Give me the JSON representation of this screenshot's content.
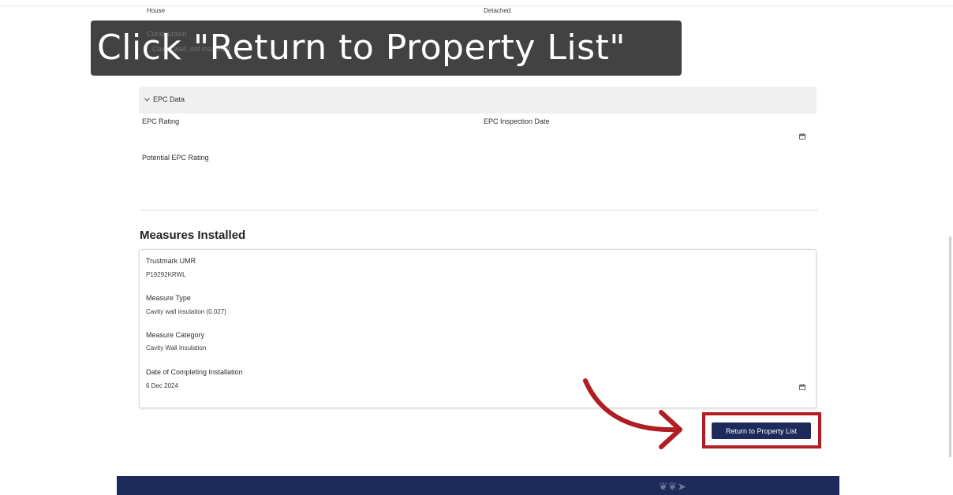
{
  "top_fields": {
    "left_value": "House",
    "right_value": "Detached",
    "construction_label": "Construction",
    "construction_value": "Cavity wall, not insulated"
  },
  "instruction": {
    "text": "Click \"Return to Property List\""
  },
  "epc_section": {
    "header": "EPC Data",
    "epc_rating_label": "EPC Rating",
    "epc_inspection_date_label": "EPC Inspection Date",
    "potential_epc_rating_label": "Potential EPC Rating"
  },
  "measures": {
    "heading": "Measures Installed",
    "trustmark_label": "Trustmark UMR",
    "trustmark_value": "P19292KRWL",
    "measure_type_label": "Measure Type",
    "measure_type_value": "Cavity wall insulation (0.027)",
    "measure_category_label": "Measure Category",
    "measure_category_value": "Cavity Wall Insulation",
    "completion_date_label": "Date of Completing Installation",
    "completion_date_value": "6 Dec 2024"
  },
  "return_button_label": "Return to Property List",
  "colors": {
    "primary_button": "#1e2a5a",
    "highlight": "#b01e23",
    "footer": "#1c2a5c"
  }
}
